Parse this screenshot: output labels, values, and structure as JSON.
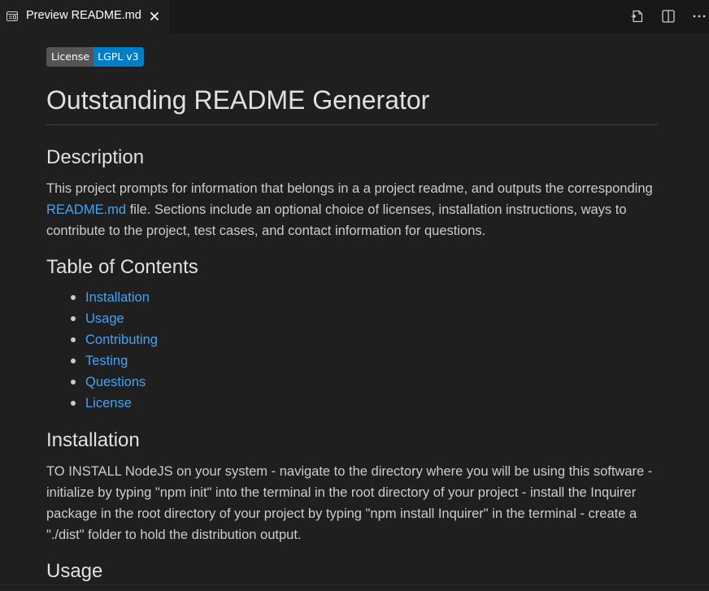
{
  "tab": {
    "title": "Preview README.md",
    "icon": "preview-icon",
    "close_icon": "close-icon"
  },
  "actions": [
    {
      "name": "open-source-icon"
    },
    {
      "name": "split-editor-icon"
    },
    {
      "name": "more-actions-icon"
    }
  ],
  "badge": {
    "left": "License",
    "right": "LGPL v3",
    "left_color": "#555555",
    "right_color": "#007ec6"
  },
  "title": "Outstanding README Generator",
  "description": {
    "heading": "Description",
    "text_before": "This project prompts for information that belongs in a a project readme, and outputs the corresponding ",
    "link": "README.md",
    "text_after": " file. Sections include an optional choice of licenses, installation instructions, ways to contribute to the project, test cases, and contact information for questions."
  },
  "toc": {
    "heading": "Table of Contents",
    "items": [
      "Installation",
      "Usage",
      "Contributing",
      "Testing",
      "Questions",
      "License"
    ]
  },
  "installation": {
    "heading": "Installation",
    "text": "TO INSTALL NodeJS on your system - navigate to the directory where you will be using this software - initialize by typing \"npm init\" into the terminal in the root directory of your project - install the Inquirer package in the root directory of your project by typing \"npm install Inquirer\" in the terminal - create a \"./dist\" folder to hold the distribution output."
  },
  "usage": {
    "heading": "Usage"
  },
  "colors": {
    "link": "#4aa1f0",
    "background": "#1f1f1f"
  }
}
